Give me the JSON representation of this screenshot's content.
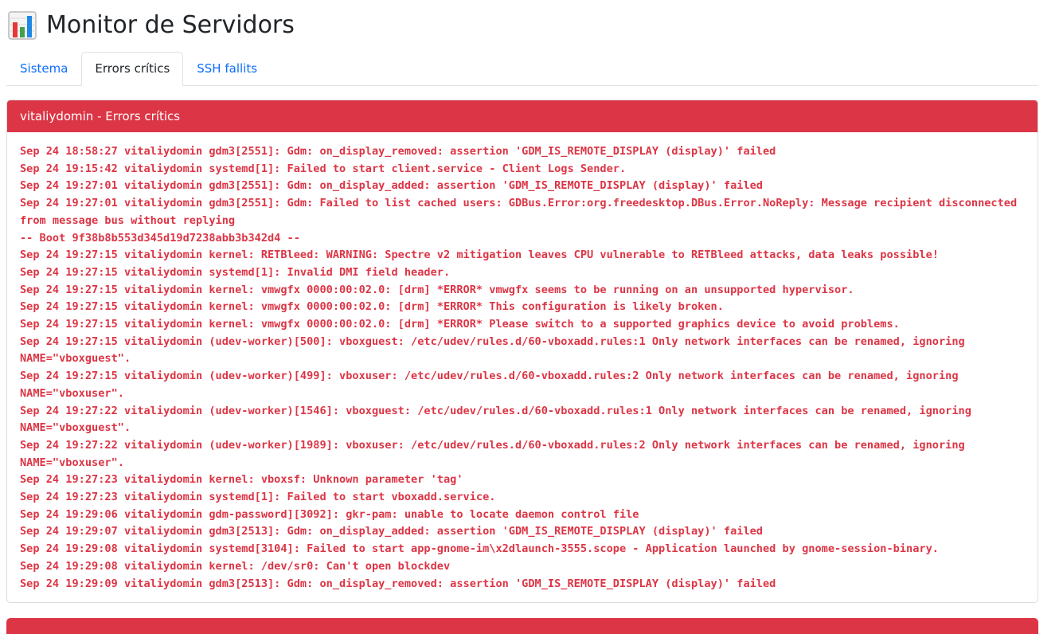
{
  "app": {
    "title": "Monitor de Servidors",
    "title_icon": "bar-chart-icon"
  },
  "tabs": [
    {
      "label": "Sistema",
      "active": false
    },
    {
      "label": "Errors crítics",
      "active": true
    },
    {
      "label": "SSH fallits",
      "active": false
    }
  ],
  "card": {
    "header": "vitaliydomin - Errors crítics",
    "header_color": "#dc3545",
    "log_color": "#dc3545",
    "lines": [
      "Sep 24 18:58:27 vitaliydomin gdm3[2551]: Gdm: on_display_removed: assertion 'GDM_IS_REMOTE_DISPLAY (display)' failed",
      "Sep 24 19:15:42 vitaliydomin systemd[1]: Failed to start client.service - Client Logs Sender.",
      "Sep 24 19:27:01 vitaliydomin gdm3[2551]: Gdm: on_display_added: assertion 'GDM_IS_REMOTE_DISPLAY (display)' failed",
      "Sep 24 19:27:01 vitaliydomin gdm3[2551]: Gdm: Failed to list cached users: GDBus.Error:org.freedesktop.DBus.Error.NoReply: Message recipient disconnected from message bus without replying",
      "-- Boot 9f38b8b553d345d19d7238abb3b342d4 --",
      "Sep 24 19:27:15 vitaliydomin kernel: RETBleed: WARNING: Spectre v2 mitigation leaves CPU vulnerable to RETBleed attacks, data leaks possible!",
      "Sep 24 19:27:15 vitaliydomin systemd[1]: Invalid DMI field header.",
      "Sep 24 19:27:15 vitaliydomin kernel: vmwgfx 0000:00:02.0: [drm] *ERROR* vmwgfx seems to be running on an unsupported hypervisor.",
      "Sep 24 19:27:15 vitaliydomin kernel: vmwgfx 0000:00:02.0: [drm] *ERROR* This configuration is likely broken.",
      "Sep 24 19:27:15 vitaliydomin kernel: vmwgfx 0000:00:02.0: [drm] *ERROR* Please switch to a supported graphics device to avoid problems.",
      "Sep 24 19:27:15 vitaliydomin (udev-worker)[500]: vboxguest: /etc/udev/rules.d/60-vboxadd.rules:1 Only network interfaces can be renamed, ignoring NAME=\"vboxguest\".",
      "Sep 24 19:27:15 vitaliydomin (udev-worker)[499]: vboxuser: /etc/udev/rules.d/60-vboxadd.rules:2 Only network interfaces can be renamed, ignoring NAME=\"vboxuser\".",
      "Sep 24 19:27:22 vitaliydomin (udev-worker)[1546]: vboxguest: /etc/udev/rules.d/60-vboxadd.rules:1 Only network interfaces can be renamed, ignoring NAME=\"vboxguest\".",
      "Sep 24 19:27:22 vitaliydomin (udev-worker)[1989]: vboxuser: /etc/udev/rules.d/60-vboxadd.rules:2 Only network interfaces can be renamed, ignoring NAME=\"vboxuser\".",
      "Sep 24 19:27:23 vitaliydomin kernel: vboxsf: Unknown parameter 'tag'",
      "Sep 24 19:27:23 vitaliydomin systemd[1]: Failed to start vboxadd.service.",
      "Sep 24 19:29:06 vitaliydomin gdm-password][3092]: gkr-pam: unable to locate daemon control file",
      "Sep 24 19:29:07 vitaliydomin gdm3[2513]: Gdm: on_display_added: assertion 'GDM_IS_REMOTE_DISPLAY (display)' failed",
      "Sep 24 19:29:08 vitaliydomin systemd[3104]: Failed to start app-gnome-im\\x2dlaunch-3555.scope - Application launched by gnome-session-binary.",
      "Sep 24 19:29:08 vitaliydomin kernel: /dev/sr0: Can't open blockdev",
      "Sep 24 19:29:09 vitaliydomin gdm3[2513]: Gdm: on_display_removed: assertion 'GDM_IS_REMOTE_DISPLAY (display)' failed"
    ]
  }
}
